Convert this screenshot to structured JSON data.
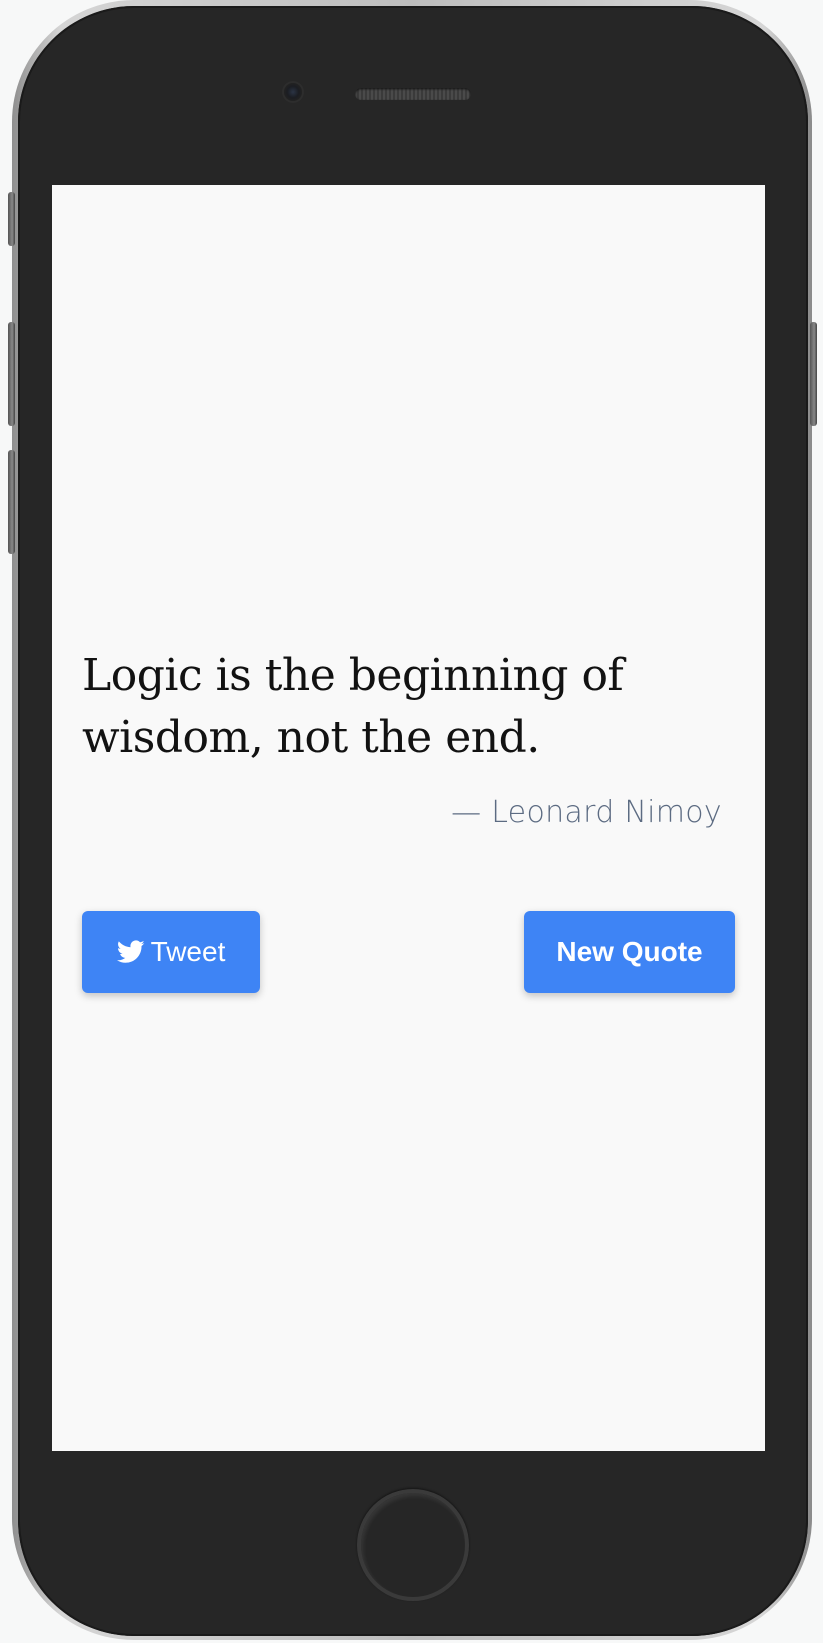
{
  "device": {
    "icons": {
      "camera": "camera-icon",
      "speaker": "speaker-grille",
      "home": "home-button"
    }
  },
  "quote": {
    "text": "Logic is the beginning of wisdom, not the end.",
    "author": "— Leonard Nimoy"
  },
  "actions": {
    "tweet_label": "Tweet",
    "tweet_icon": "twitter-icon",
    "new_quote_label": "New Quote"
  },
  "colors": {
    "button": "#3e84f5",
    "author": "#5c6b82",
    "screen_background": "#f9f9f9",
    "phone_body": "#262626"
  }
}
